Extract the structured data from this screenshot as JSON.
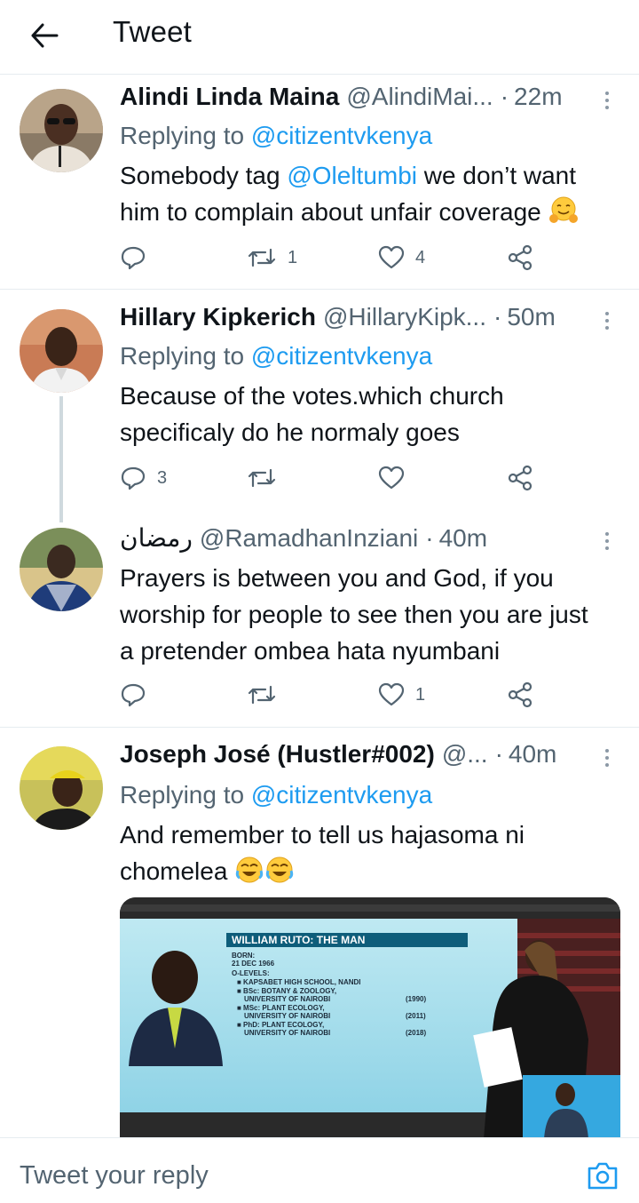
{
  "header": {
    "title": "Tweet"
  },
  "tweets": [
    {
      "name": "Alindi Linda Maina",
      "handle": "@AlindiMai...",
      "dot": "·",
      "time": "22m",
      "replying_prefix": "Replying to",
      "replying_handle": "@citizentvkenya",
      "text_part1": "Somebody tag ",
      "text_mention": "@Oleltumbi",
      "text_part2": " we don’t want him to complain about unfair coverage",
      "emoji": "hugging-face",
      "replies": "",
      "retweets": "1",
      "likes": "4"
    },
    {
      "name": "Hillary Kipkerich",
      "handle": "@HillaryKipk...",
      "dot": "·",
      "time": "50m",
      "replying_prefix": "Replying to",
      "replying_handle": "@citizentvkenya",
      "text": "Because of the votes.which church specificaly  do he normaly goes",
      "replies": "3",
      "retweets": "",
      "likes": ""
    },
    {
      "name": "رمضان",
      "handle": "@RamadhanInziani",
      "dot": "·",
      "time": "40m",
      "text": "Prayers is between you and God, if you worship for people to see then you are just a pretender ombea hata nyumbani",
      "replies": "",
      "retweets": "",
      "likes": "1"
    },
    {
      "name": "Joseph José (Hustler#002)",
      "handle": "@...",
      "dot": "·",
      "time": "40m",
      "replying_prefix": "Replying to",
      "replying_handle": "@citizentvkenya",
      "text": "And remember to tell us hajasoma ni chomelea",
      "emoji": "joy-face",
      "media": {
        "banner": "WILLIAM RUTO: THE MAN",
        "lines": [
          "BORN:",
          "21 DEC 1966",
          "O-LEVELS:",
          "■ KAPSABET HIGH SCHOOL, NANDI",
          "■ BSc: BOTANY & ZOOLOGY,",
          "UNIVERSITY OF NAIROBI",
          "■ MSc: PLANT ECOLOGY,",
          "UNIVERSITY OF NAIROBI",
          "■ PhD: PLANT ECOLOGY,",
          "UNIVERSITY OF NAIROBI"
        ],
        "years": [
          "(1990)",
          "(2011)",
          "(2018)"
        ]
      }
    }
  ],
  "reply_bar": {
    "placeholder": "Tweet your reply",
    "icon": "camera-icon"
  },
  "colors": {
    "link": "#1d9bf0",
    "secondary": "#536471",
    "border": "#e6ecf0",
    "text": "#0f1419"
  }
}
